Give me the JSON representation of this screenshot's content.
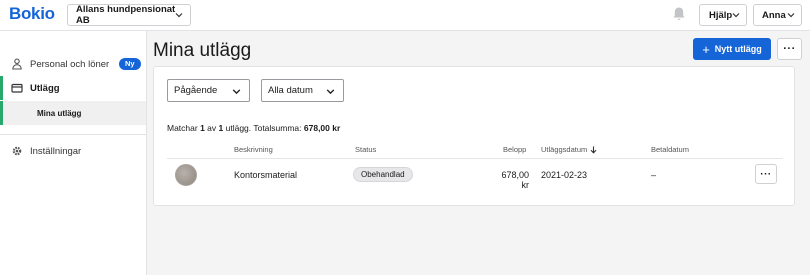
{
  "header": {
    "logo": "Bokio",
    "company": "Allans hundpensionat AB",
    "help_label": "Hjälp",
    "user_label": "Anna"
  },
  "sidebar": {
    "items": [
      {
        "label": "Personal och löner",
        "badge": "Ny",
        "icon": "person-icon"
      },
      {
        "label": "Utlägg",
        "icon": "wallet-icon"
      },
      {
        "label": "Mina utlägg"
      },
      {
        "label": "Inställningar",
        "icon": "gear-icon"
      }
    ]
  },
  "main": {
    "title": "Mina utlägg",
    "new_button_label": "Nytt utlägg",
    "filters": {
      "status": "Pågående",
      "date": "Alla datum"
    },
    "summary": {
      "prefix": "Matchar ",
      "count": "1",
      "middle": " av ",
      "total_count": "1",
      "suffix": " utlägg. Totalsumma: ",
      "total": "678,00 kr"
    },
    "table": {
      "columns": [
        "Beskrivning",
        "Status",
        "Belopp",
        "Utläggsdatum",
        "Betaldatum"
      ],
      "rows": [
        {
          "description": "Kontorsmaterial",
          "status": "Obehandlad",
          "amount": "678,00 kr",
          "date": "2021-02-23",
          "paid": "–"
        }
      ]
    }
  },
  "colors": {
    "accent": "#1565d8",
    "active_indicator": "#28a86b"
  }
}
